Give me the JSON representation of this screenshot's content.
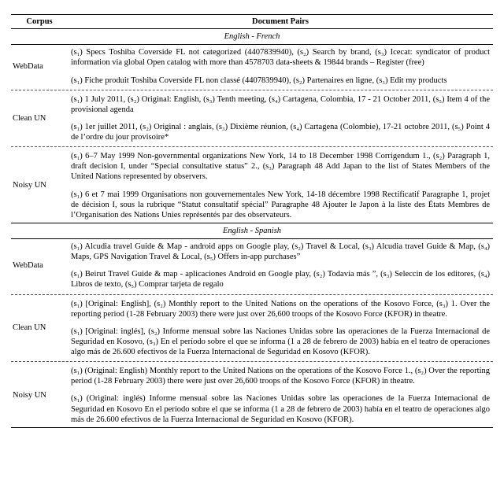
{
  "headers": {
    "corpus": "Corpus",
    "document_pairs": "Document Pairs"
  },
  "languages": {
    "en_fr": "English - French",
    "en_es": "English - Spanish"
  },
  "chart_data": {
    "type": "table",
    "title": "Example document pairs",
    "sections": [
      {
        "language_pair": "English - French",
        "rows": [
          {
            "corpus": "WebData",
            "source": "(s₁) Specs Toshiba Coverside FL not categorized (4407839940), (s₂) Search by brand, (s₃) Icecat: syndicator of product information via global Open catalog with more than 4578703 data-sheets & 19844 brands – Register (free)",
            "target": "(s₁) Fiche produit Toshiba Coverside FL non classé (4407839940), (s₂) Partenaires en ligne, (s₃) Edit my products"
          },
          {
            "corpus": "Clean UN",
            "source": "(s₁) 1 July 2011, (s₂) Original: English, (s₃) Tenth meeting, (s₄) Cartagena, Colombia, 17 - 21 October 2011, (s₅) Item 4 of the provisional agenda",
            "target": "(s₁) 1er juillet 2011, (s₂) Original : anglais, (s₃) Dixième réunion, (s₄) Cartagena (Colombie), 17-21 octobre 2011, (s₅) Point 4 de l’ordre du jour provisoire*"
          },
          {
            "corpus": "Noisy UN",
            "source": "(s₁) 6–7 May 1999 Non-governmental organizations New York, 14 to 18 December 1998 Corrigendum 1., (s₂) Paragraph 1, draft decision I, under “Special consultative status” 2., (s₃) Paragraph 48 Add Japan to the list of States Members of the United Nations represented by observers.",
            "target": "(s₁) 6 et 7 mai 1999 Organisations non gouvernementales New York, 14-18 décembre 1998 Rectificatif Paragraphe 1, projet de décision I, sous la rubrique “Statut consultatif spécial” Paragraphe 48 Ajouter le Japon à la liste des États Membres de l’Organisation des Nations Unies représentés par des observateurs."
          }
        ]
      },
      {
        "language_pair": "English - Spanish",
        "rows": [
          {
            "corpus": "WebData",
            "source": "(s₁) Alcudia travel Guide & Map - android apps on Google play, (s₂) Travel & Local, (s₃) Alcudia travel Guide & Map, (s₄) Maps, GPS Navigation Travel & Local, (s₅) Offers in-app purchases”",
            "target": "(s₁) Beirut Travel Guide & map - aplicaciones Android en Google play, (s₂) Todavía más ”, (s₃) Seleccin de los editores, (s₄) Libros de texto, (s₅) Comprar tarjeta de regalo"
          },
          {
            "corpus": "Clean UN",
            "source": "(s₁) [Original: English], (s₂) Monthly report to the United Nations on the operations of the Kosovo Force, (s₃) 1. Over the reporting period (1-28 February 2003) there were just over 26,600 troops of the Kosovo Force (KFOR) in theatre.",
            "target": "(s₁) [Original: inglés], (s₂) Informe mensual sobre las Naciones Unidas sobre las operaciones de la Fuerza Internacional de Seguridad en Kosovo, (s₃) En el período sobre el que se informa (1 a 28 de febrero de 2003) había en el teatro de operaciones algo más de 26.600 efectivos de la Fuerza Internacional de Seguridad en Kosovo (KFOR)."
          },
          {
            "corpus": "Noisy UN",
            "source": "(s₁) (Original: English) Monthly report to the United Nations on the operations of the Kosovo Force 1., (s₂) Over the reporting period (1-28 February 2003) there were just over 26,600 troops of the Kosovo Force (KFOR) in theatre.",
            "target": "(s₁) (Original: inglés) Informe mensual sobre las Naciones Unidas sobre las operaciones de la Fuerza Internacional de Seguridad en Kosovo En el período sobre el que se informa (1 a 28 de febrero de 2003) había en el teatro de operaciones algo más de 26.600 efectivos de la Fuerza Internacional de Seguridad en Kosovo (KFOR)."
          }
        ]
      }
    ]
  }
}
